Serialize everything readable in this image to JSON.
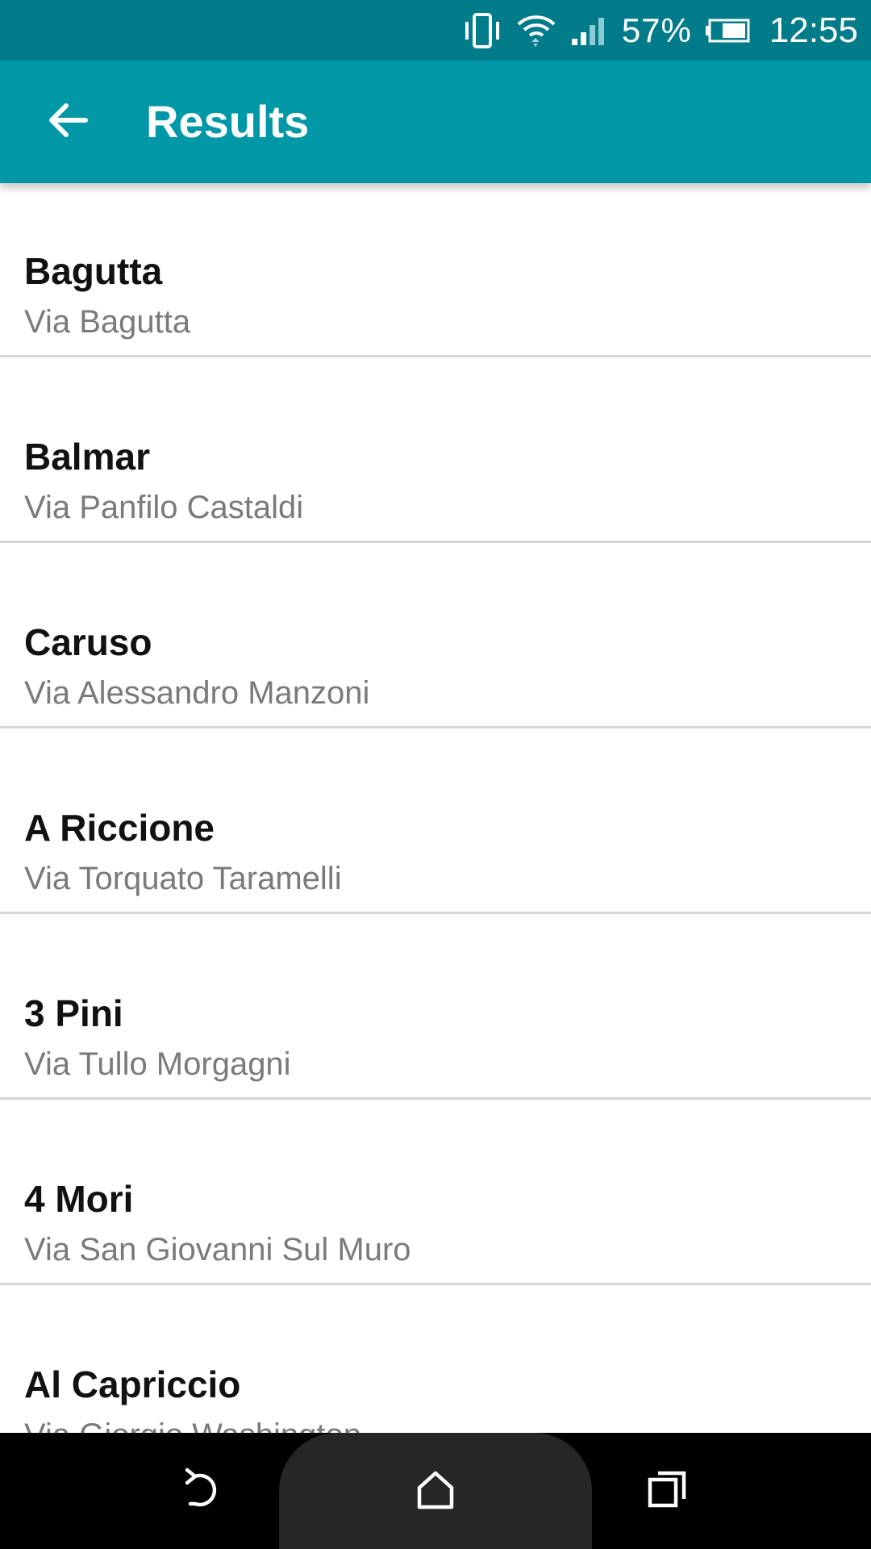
{
  "status_bar": {
    "battery_percent": "57%",
    "time": "12:55",
    "icons": [
      "vibrate-icon",
      "wifi-icon",
      "signal-icon",
      "battery-icon"
    ]
  },
  "app_bar": {
    "title": "Results",
    "back_icon": "arrow-back-icon"
  },
  "results": [
    {
      "name": "Bagutta",
      "address": "Via Bagutta"
    },
    {
      "name": "Balmar",
      "address": "Via Panfilo Castaldi"
    },
    {
      "name": "Caruso",
      "address": "Via Alessandro Manzoni"
    },
    {
      "name": "A Riccione",
      "address": "Via Torquato Taramelli"
    },
    {
      "name": "3 Pini",
      "address": "Via Tullo Morgagni"
    },
    {
      "name": "4 Mori",
      "address": "Via San Giovanni Sul Muro"
    },
    {
      "name": "Al Capriccio",
      "address": "Via Giorgio Washington"
    }
  ],
  "nav_bar": {
    "icons": [
      "back-icon",
      "home-icon",
      "recents-icon"
    ]
  },
  "colors": {
    "status_bar": "#007b8a",
    "app_bar": "#0097a7",
    "primary_text": "#111111",
    "secondary_text": "#7a7a7a",
    "divider": "#d6d6d6"
  }
}
